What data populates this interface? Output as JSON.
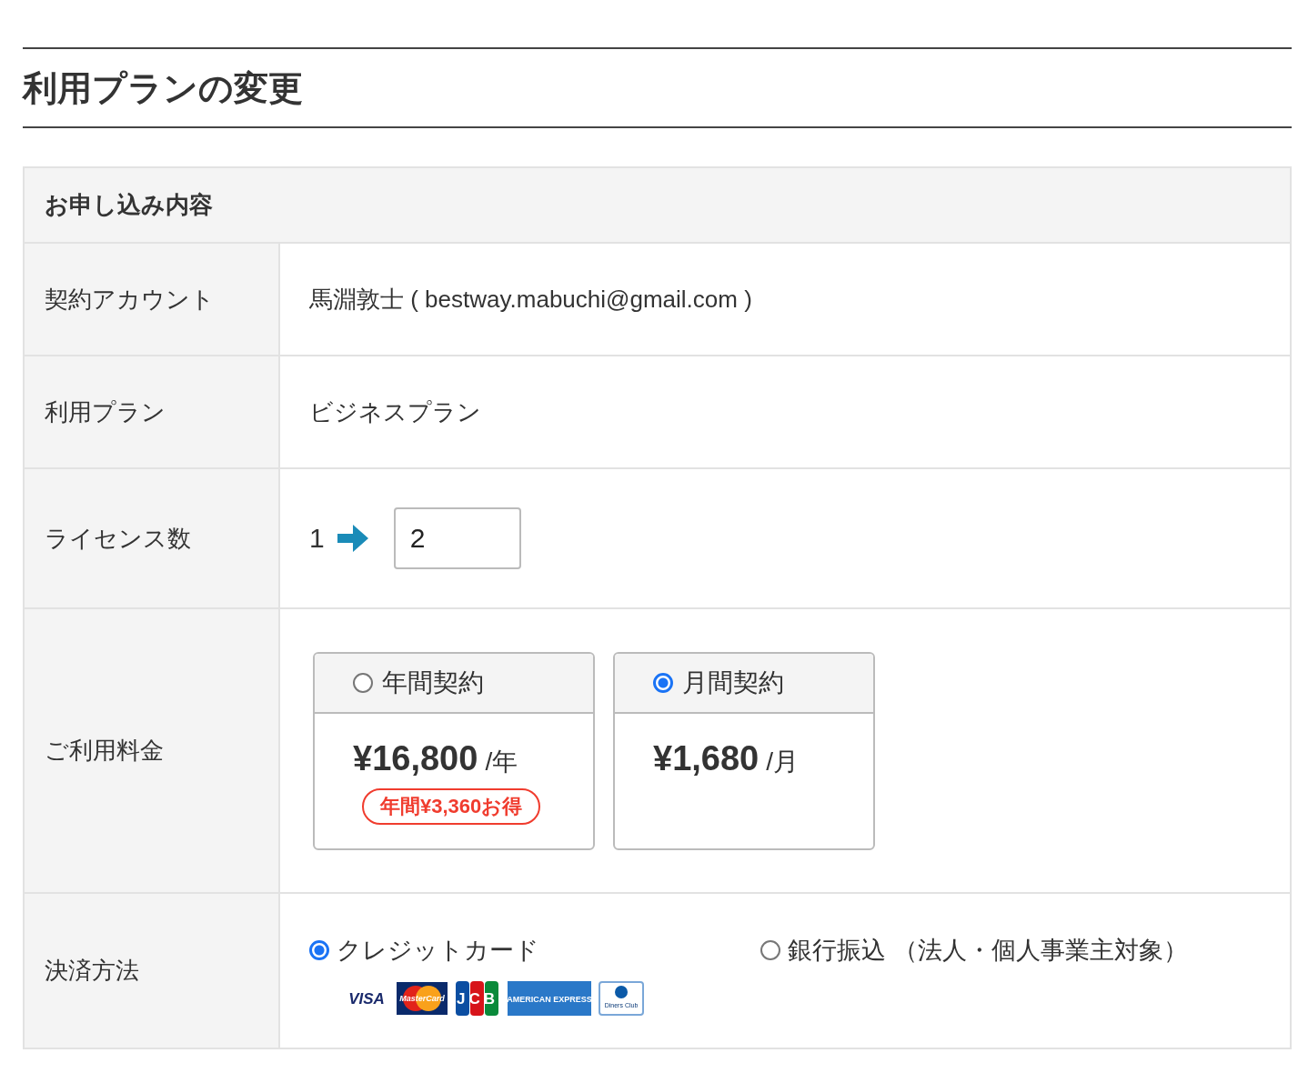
{
  "page_title": "利用プランの変更",
  "form": {
    "heading": "お申し込み内容",
    "rows": [
      {
        "kind": "text",
        "label": "契約アカウント",
        "value": "馬淵敦士 ( bestway.mabuchi@gmail.com )"
      },
      {
        "kind": "text",
        "label": "利用プラン",
        "value": "ビジネスプラン"
      },
      {
        "kind": "license",
        "label": "ライセンス数",
        "current": "1",
        "value": "2"
      },
      {
        "kind": "pricing",
        "label": "ご利用料金",
        "options": [
          {
            "name": "年間契約",
            "selected": false,
            "price": "¥16,800",
            "unit": "/年",
            "badge": "年間¥3,360お得"
          },
          {
            "name": "月間契約",
            "selected": true,
            "price": "¥1,680",
            "unit": "/月"
          }
        ]
      },
      {
        "kind": "payment",
        "label": "決済方法",
        "options": [
          {
            "name": "クレジットカード",
            "selected": true,
            "card_logos": [
              {
                "kind": "visa",
                "text": "VISA"
              },
              {
                "kind": "mastercard",
                "text": "MasterCard"
              },
              {
                "kind": "jcb",
                "text": "JCB"
              },
              {
                "kind": "amex",
                "text": "AMERICAN EXPRESS"
              },
              {
                "kind": "diners",
                "text": "Diners Club"
              }
            ]
          },
          {
            "name": "銀行振込 （法人・個人事業主対象）",
            "selected": false
          }
        ]
      }
    ]
  }
}
